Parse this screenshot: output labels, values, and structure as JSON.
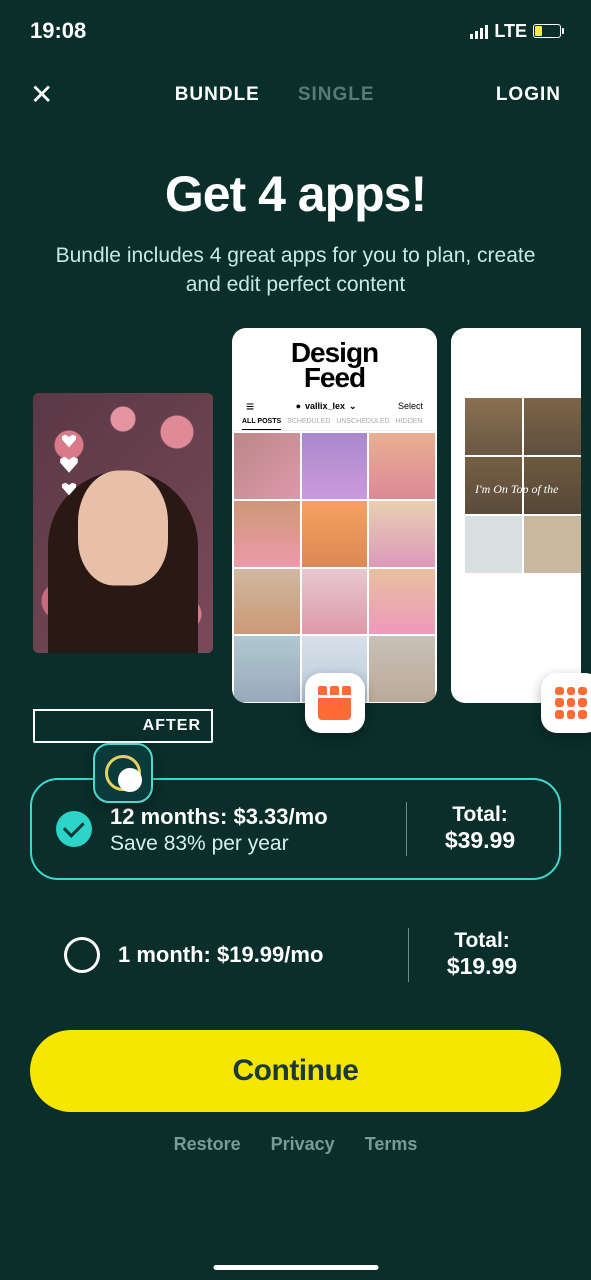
{
  "status": {
    "time": "19:08",
    "network": "LTE"
  },
  "nav": {
    "tabs": {
      "bundle": "BUNDLE",
      "single": "SINGLE"
    },
    "login": "LOGIN"
  },
  "hero": {
    "headline": "Get 4 apps!",
    "subhead": "Bundle includes 4 great apps for you to plan, create and edit perfect content"
  },
  "cards": {
    "c1_after": "AFTER",
    "c2_title1": "Design",
    "c2_title2": "Feed",
    "c2_user": "vallix_lex",
    "c2_select": "Select",
    "c2_tab_all": "ALL POSTS",
    "c3_caption": "I'm On Top of the"
  },
  "plans": {
    "p1": {
      "title": "12 months: $3.33/mo",
      "sub": "Save 83% per year",
      "total_label": "Total:",
      "total_val": "$39.99"
    },
    "p2": {
      "title": "1 month: $19.99/mo",
      "total_label": "Total:",
      "total_val": "$19.99"
    }
  },
  "cta": "Continue",
  "footer": {
    "restore": "Restore",
    "privacy": "Privacy",
    "terms": "Terms"
  }
}
